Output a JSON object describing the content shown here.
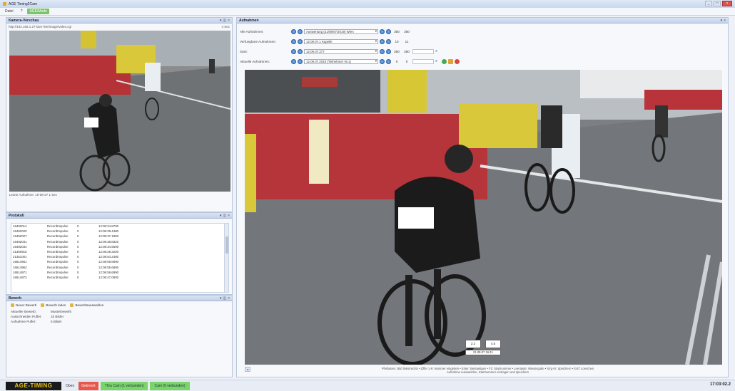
{
  "window": {
    "title": "AGE Timing2Cam"
  },
  "menu": {
    "items": [
      "Datei",
      "?",
      "AGE/Mode"
    ]
  },
  "camera_panel": {
    "title": "Kamera-Vorschau",
    "url": "http://192.168.1.27 kam-live/image/video.cgi",
    "url_suffix": "4 Sec",
    "footer": "Letzte Aufnahme: 19-08-27 1  Sec"
  },
  "protocol_panel": {
    "title": "Protokoll",
    "rows": [
      [
        "16492014",
        "RecordImpulse",
        "0",
        "12:08:24.8700"
      ],
      [
        "16492020",
        "RecordImpulse",
        "0",
        "12:08:28.4480"
      ],
      [
        "16492027",
        "RecordImpulse",
        "0",
        "12:08:37.1890"
      ],
      [
        "16492031",
        "RecordImpulse",
        "0",
        "12:08:38.8320"
      ],
      [
        "16492034",
        "RecordImpulse",
        "0",
        "12:08:34.5590"
      ],
      [
        "21350916",
        "RecordImpulse",
        "0",
        "12:08:28.3200"
      ],
      [
        "21351001",
        "RecordImpulse",
        "0",
        "12:08:54.2480"
      ],
      [
        "16514961",
        "RecordImpulse",
        "0",
        "12:08:59.6890"
      ],
      [
        "16514962",
        "RecordImpulse",
        "0",
        "12:08:55.6890"
      ],
      [
        "16514971",
        "RecordImpulse",
        "0",
        "12:08:59.6890"
      ],
      [
        "16514972",
        "RecordImpulse",
        "0",
        "12:08:47.0800"
      ]
    ]
  },
  "event_panel": {
    "title": "Bewerb",
    "buttons": [
      "Neuer Bewerb",
      "Bewerb laden",
      "Bewerbsauswahlen"
    ],
    "fields": [
      {
        "label": "Aktueller Bewerb:",
        "value": "Musterbewerb"
      },
      {
        "label": "Ausschneiden Puffer:",
        "value": "15 Bilder"
      },
      {
        "label": "Aufnahme Puffer:",
        "value": "5 Bilder"
      }
    ]
  },
  "recording_panel": {
    "title": "Aufnahmen",
    "rows": [
      {
        "label": "Alle Aufnahmen:",
        "combo": "Auswertung (21/09/07/2019) Wien",
        "n1": "350",
        "n2": "350"
      },
      {
        "label": "Verfuegbare Aufnahmen:",
        "combo": "12.09.07.1 Kapelle",
        "n1": "10",
        "n2": "11"
      },
      {
        "label": "Start:",
        "combo": "12.09.07.377",
        "n1": "350",
        "n2": "350"
      },
      {
        "label": "Aktuelle Aufnahmen:",
        "combo": "12.09.07.2019 (Teilnehmer Nr.1)",
        "n1": "0",
        "n2": "0"
      }
    ],
    "footer_hint": "Pfeiltasten: Bild links/rechts • Ziffer 1-9: Nummer eingeben • Enter: Bestaetigen • F2: Startnummer • Leertaste: Wiedergabe • Strg+S: Speichern • Entf: Loeschen",
    "footer_hint2": "Aufnahme auswaehlen, Startnummer eintragen und speichern"
  },
  "overlay": {
    "box1": "2:3",
    "box2": "4:5",
    "box3": "21.09.07 16:41"
  },
  "status": {
    "logo": "AGE-TIMING",
    "text": "Oben",
    "red": "Getrennt",
    "green1": "Thru Cam (1 verbunden)",
    "green2": "Cam (0 verbunden)",
    "time": "17:03:02.2"
  }
}
